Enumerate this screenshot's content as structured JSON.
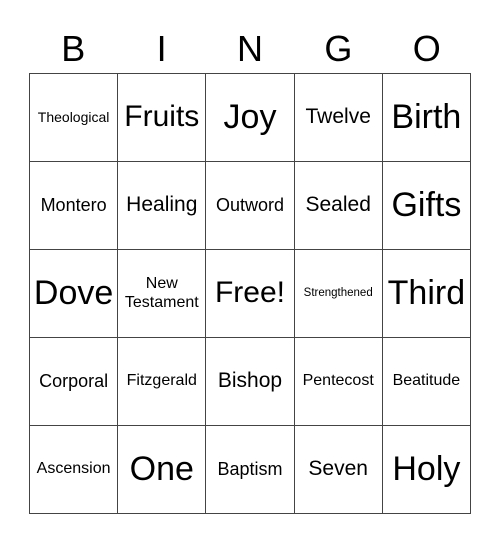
{
  "header": [
    "B",
    "I",
    "N",
    "G",
    "O"
  ],
  "cells": [
    {
      "text": "Theological",
      "size": "xs"
    },
    {
      "text": "Fruits",
      "size": "l"
    },
    {
      "text": "Joy",
      "size": "xl"
    },
    {
      "text": "Twelve",
      "size": "m"
    },
    {
      "text": "Birth",
      "size": "xl"
    },
    {
      "text": "Montero",
      "size": "sm"
    },
    {
      "text": "Healing",
      "size": "m"
    },
    {
      "text": "Outword",
      "size": "sm"
    },
    {
      "text": "Sealed",
      "size": "m"
    },
    {
      "text": "Gifts",
      "size": "xl"
    },
    {
      "text": "Dove",
      "size": "xl"
    },
    {
      "text": "New Testament",
      "size": "s"
    },
    {
      "text": "Free!",
      "size": "l"
    },
    {
      "text": "Strengthened",
      "size": "xxs"
    },
    {
      "text": "Third",
      "size": "xl"
    },
    {
      "text": "Corporal",
      "size": "sm"
    },
    {
      "text": "Fitzgerald",
      "size": "s"
    },
    {
      "text": "Bishop",
      "size": "m"
    },
    {
      "text": "Pentecost",
      "size": "s"
    },
    {
      "text": "Beatitude",
      "size": "s"
    },
    {
      "text": "Ascension",
      "size": "s"
    },
    {
      "text": "One",
      "size": "xl"
    },
    {
      "text": "Baptism",
      "size": "sm"
    },
    {
      "text": "Seven",
      "size": "m"
    },
    {
      "text": "Holy",
      "size": "xl"
    }
  ]
}
